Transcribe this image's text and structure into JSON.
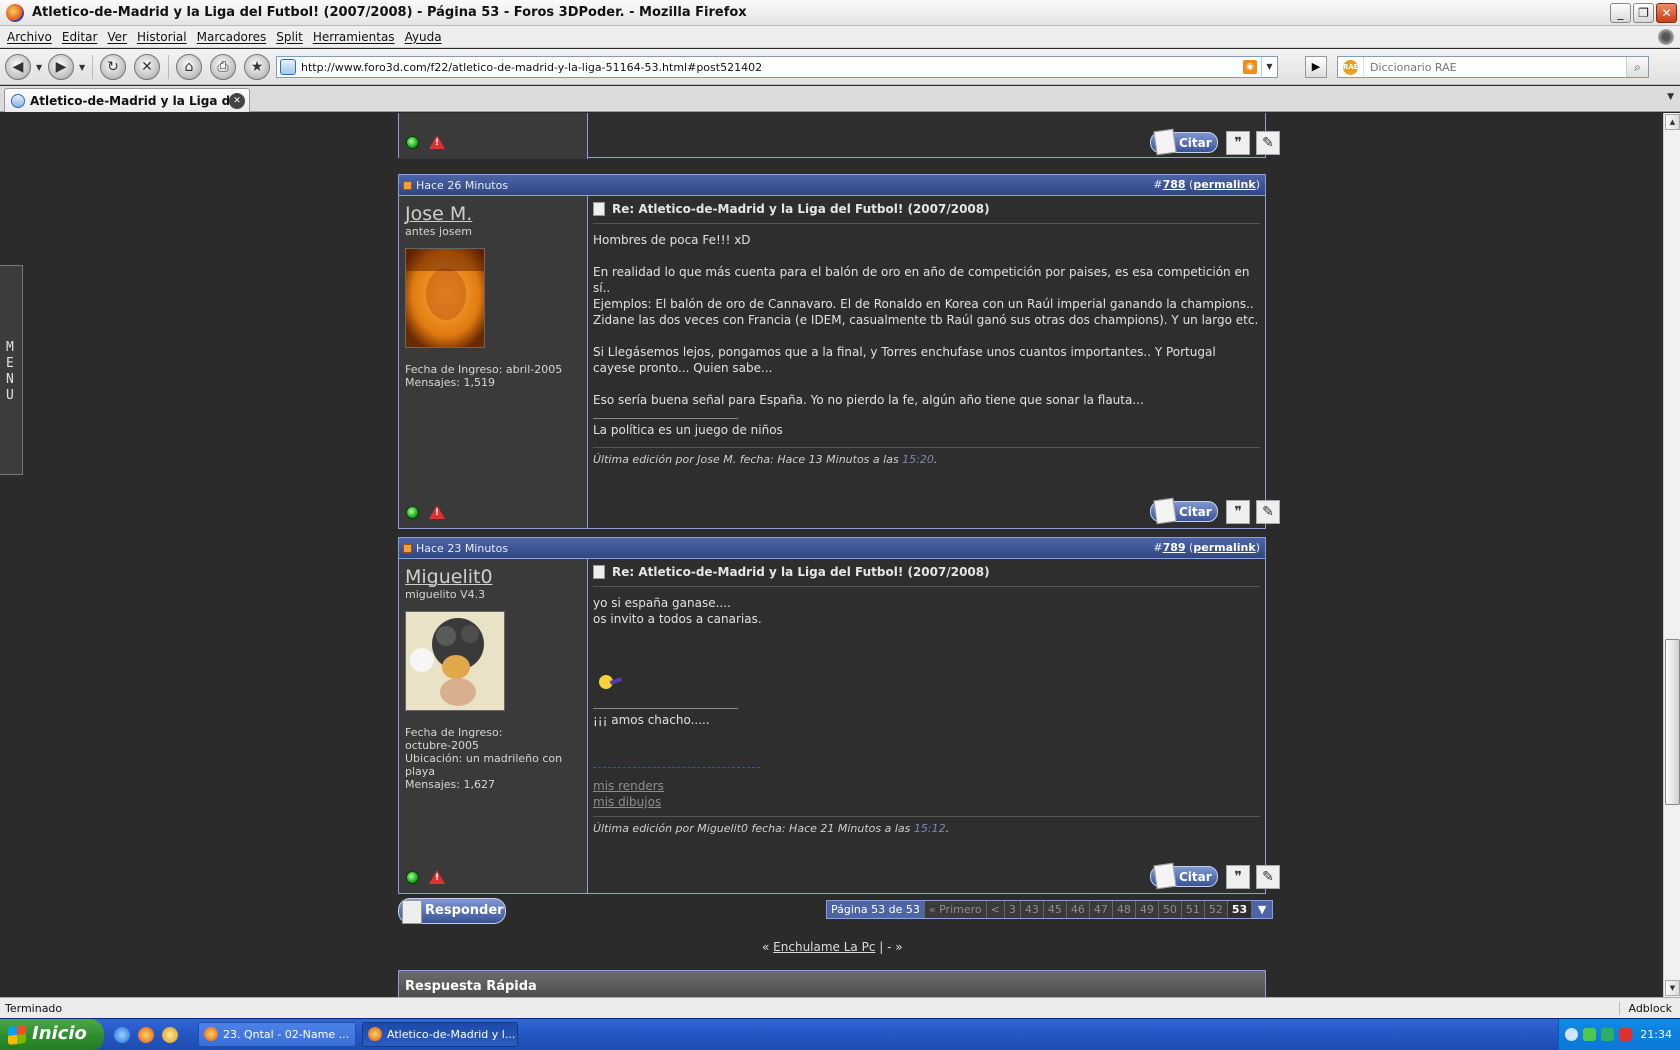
{
  "window": {
    "title": "Atletico-de-Madrid y la Liga del Futbol! (2007/2008) - Página 53 - Foros 3DPoder. - Mozilla Firefox",
    "min": "_",
    "max": "❐",
    "close": "✕"
  },
  "menubar": {
    "items": [
      "Archivo",
      "Editar",
      "Ver",
      "Historial",
      "Marcadores",
      "Split",
      "Herramientas",
      "Ayuda"
    ]
  },
  "navbar": {
    "url": "http://www.foro3d.com/f22/atletico-de-madrid-y-la-liga-51164-53.html#post521402",
    "search_placeholder": "Diccionario RAE"
  },
  "tabs": [
    {
      "label": "Atletico-de-Madrid y la Liga del F..."
    }
  ],
  "side_menu": {
    "label": "MENU"
  },
  "posts": [
    {
      "time": "Hace 26 Minutos",
      "number": "788",
      "permalink": "permalink",
      "username": "Jose M.",
      "usertitle": "antes josem",
      "info": [
        "Fecha de Ingreso: abril-2005",
        "Mensajes: 1,519"
      ],
      "title": "Re: Atletico-de-Madrid y la Liga del Futbol! (2007/2008)",
      "body": "Hombres de poca Fe!!! xD\n\nEn realidad lo que más cuenta para el balón de oro en año de competición por paises, es esa competición en sí..\nEjemplos: El balón de oro de Cannavaro. El de Ronaldo en Korea con un Raúl imperial ganando la champions.. Zidane las dos veces con Francia (e IDEM, casualmente tb Raúl ganó sus otras dos champions). Y un largo etc.\n\nSi Llegásemos lejos, pongamos que a la final, y Torres enchufase unos cuantos importantes.. Y Portugal cayese pronto... Quien sabe...\n\nEso sería buena señal para España. Yo no pierdo la fe, algún año tiene que sonar la flauta...",
      "signature": "La política es un juego de niños",
      "edit_prefix": "Última edición por Jose M. fecha: Hace 13 Minutos a las ",
      "edit_time": "15:20",
      "edit_suffix": "."
    },
    {
      "time": "Hace 23 Minutos",
      "number": "789",
      "permalink": "permalink",
      "username": "Miguelit0",
      "usertitle": "miguelito V4.3",
      "info": [
        "Fecha de Ingreso:",
        "octubre-2005",
        "Ubicación: un madrileño con playa",
        "Mensajes: 1,627"
      ],
      "title": "Re: Atletico-de-Madrid y la Liga del Futbol! (2007/2008)",
      "body": "yo si españa ganase....\nos invito a todos a canarias.",
      "signature": "¡¡¡ amos chacho.....",
      "links": [
        "mis renders",
        "mis dibujos"
      ],
      "edit_prefix": "Última edición por Miguelit0 fecha: Hace 21 Minutos a las ",
      "edit_time": "15:12",
      "edit_suffix": "."
    }
  ],
  "buttons": {
    "quote": "Citar",
    "reply": "Responder"
  },
  "pager": {
    "label": "Página 53 de 53",
    "first": "« Primero",
    "prev": "<",
    "pages": [
      "3",
      "43",
      "45",
      "46",
      "47",
      "48",
      "49",
      "50",
      "51",
      "52"
    ],
    "current": "53",
    "menu": "▼"
  },
  "footer": {
    "prefix": "«",
    "link": "Enchulame La Pc",
    "suffix": "| - »"
  },
  "quick_reply": {
    "title": "Respuesta Rápida"
  },
  "statusbar": {
    "text": "Terminado",
    "adblock": "Adblock"
  },
  "taskbar": {
    "start": "Inicio",
    "tasks": [
      "23. Qntal - 02-Name ...",
      "Atletico-de-Madrid y l..."
    ],
    "clock": "21:34"
  },
  "colors": {
    "post_header": "#4d65a8",
    "post_border": "#8ba0d8",
    "page_bg": "#2b2b2b",
    "edit_time": "#7d86b8"
  }
}
